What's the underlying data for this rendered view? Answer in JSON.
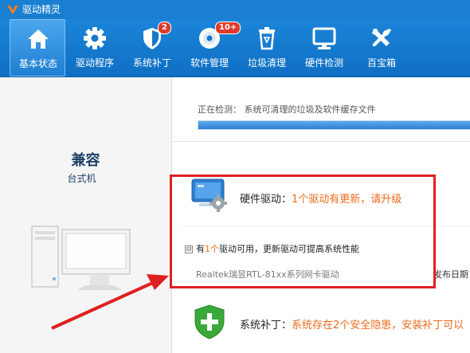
{
  "window": {
    "title": "驱动精灵"
  },
  "toolbar": {
    "items": [
      {
        "label": "基本状态",
        "icon": "home-icon",
        "active": true
      },
      {
        "label": "驱动程序",
        "icon": "gear-icon"
      },
      {
        "label": "系统补丁",
        "icon": "shield-icon",
        "badge": "2"
      },
      {
        "label": "软件管理",
        "icon": "disc-icon",
        "badge": "10+"
      },
      {
        "label": "垃圾清理",
        "icon": "trash-icon"
      },
      {
        "label": "硬件检测",
        "icon": "monitor-icon"
      },
      {
        "label": "百宝箱",
        "icon": "tools-icon"
      }
    ]
  },
  "device": {
    "name": "兼容",
    "type": "台式机"
  },
  "scan": {
    "label": "正在检测： 系统可清理的垃圾及软件缓存文件",
    "progress": 1.0
  },
  "hardware": {
    "title": "硬件驱动：",
    "status": "1个驱动有更新，请升级",
    "available_prefix": "有",
    "available_count": "1个",
    "available_suffix": "驱动可用，更新驱动可提高系统性能",
    "collapse_glyph": "⊟",
    "driver_name": "Realtek瑞昱RTL-81xx系列网卡驱动",
    "driver_extra": "发布日期"
  },
  "patch": {
    "title": "系统补丁：",
    "status": "系统存在2个安全隐患，安装补丁可以"
  },
  "colors": {
    "accent": "#1a7fd1",
    "highlight": "#e02020",
    "warning": "#ee6a1c"
  }
}
